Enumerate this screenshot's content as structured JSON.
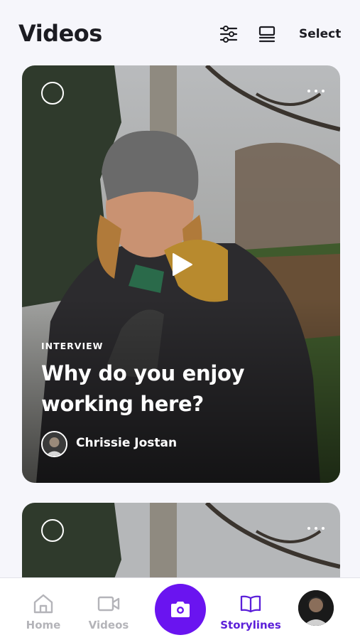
{
  "header": {
    "title": "Videos",
    "filter_icon": "sliders-icon",
    "layout_icon": "view-stacked-icon",
    "select_label": "Select"
  },
  "cards": [
    {
      "type_label": "INTERVIEW",
      "title": "Why do you enjoy working here?",
      "author": "Chrissie Jostan",
      "play_icon": "play-icon",
      "more_icon": "more-horizontal-icon"
    },
    {
      "more_icon": "more-horizontal-icon"
    }
  ],
  "tabbar": {
    "items": [
      {
        "label": "Home",
        "icon": "home-icon",
        "active": false
      },
      {
        "label": "Videos",
        "icon": "video-camera-icon",
        "active": false
      },
      {
        "label": "",
        "icon": "camera-icon",
        "active": false
      },
      {
        "label": "Storylines",
        "icon": "book-open-icon",
        "active": true
      },
      {
        "label": "",
        "icon": "profile-avatar",
        "active": false
      }
    ]
  },
  "colors": {
    "accent": "#6a14f0",
    "active_tab": "#5b1fd9",
    "inactive_tab": "#b4b4b9",
    "background": "#f6f6fb"
  }
}
